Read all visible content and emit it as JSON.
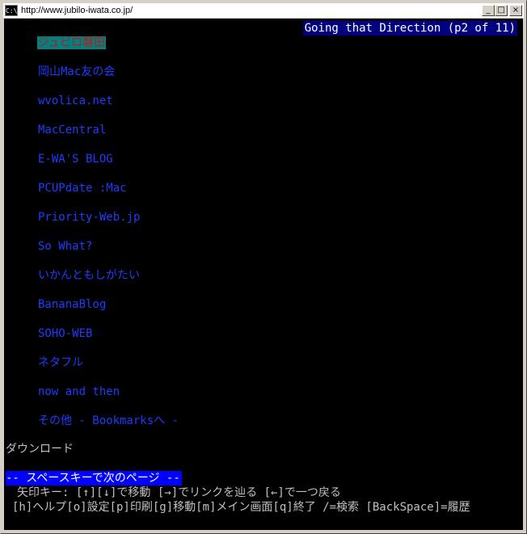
{
  "window": {
    "icon_text": "C:\\",
    "title": "http://www.jubilo-iwata.co.jp/",
    "buttons": {
      "minimize": "_",
      "maximize": "□",
      "close": "×"
    }
  },
  "header": {
    "indicator": "Going that Direction (p2 of 11)"
  },
  "links": [
    {
      "label": "ジュビロ磐田",
      "selected": true
    },
    {
      "label": "岡山Mac友の会"
    },
    {
      "label": "wvolica.net"
    },
    {
      "label": "MacCentral"
    },
    {
      "label": "E-WA'S BLOG"
    },
    {
      "label": "PCUPdate :Mac"
    },
    {
      "label": "Priority-Web.jp"
    },
    {
      "label": "So What?"
    },
    {
      "label": "いかんともしがたい"
    },
    {
      "label": "BananaBlog"
    },
    {
      "label": "SOHO-WEB"
    },
    {
      "label": "ネタフル"
    },
    {
      "label": "now and then"
    },
    {
      "label": "その他 - Bookmarksへ -"
    }
  ],
  "download": "ダウンロード",
  "footer": {
    "status": "-- スペースキーで次のページ --",
    "help1": "矢印キー: [↑][↓]で移動 [→]でリンクを辿る [←]で一つ戻る",
    "help2": "[h]ヘルプ[o]設定[p]印刷[g]移動[m]メイン画面[q]終了 /=検索 [BackSpace]=履歴"
  }
}
